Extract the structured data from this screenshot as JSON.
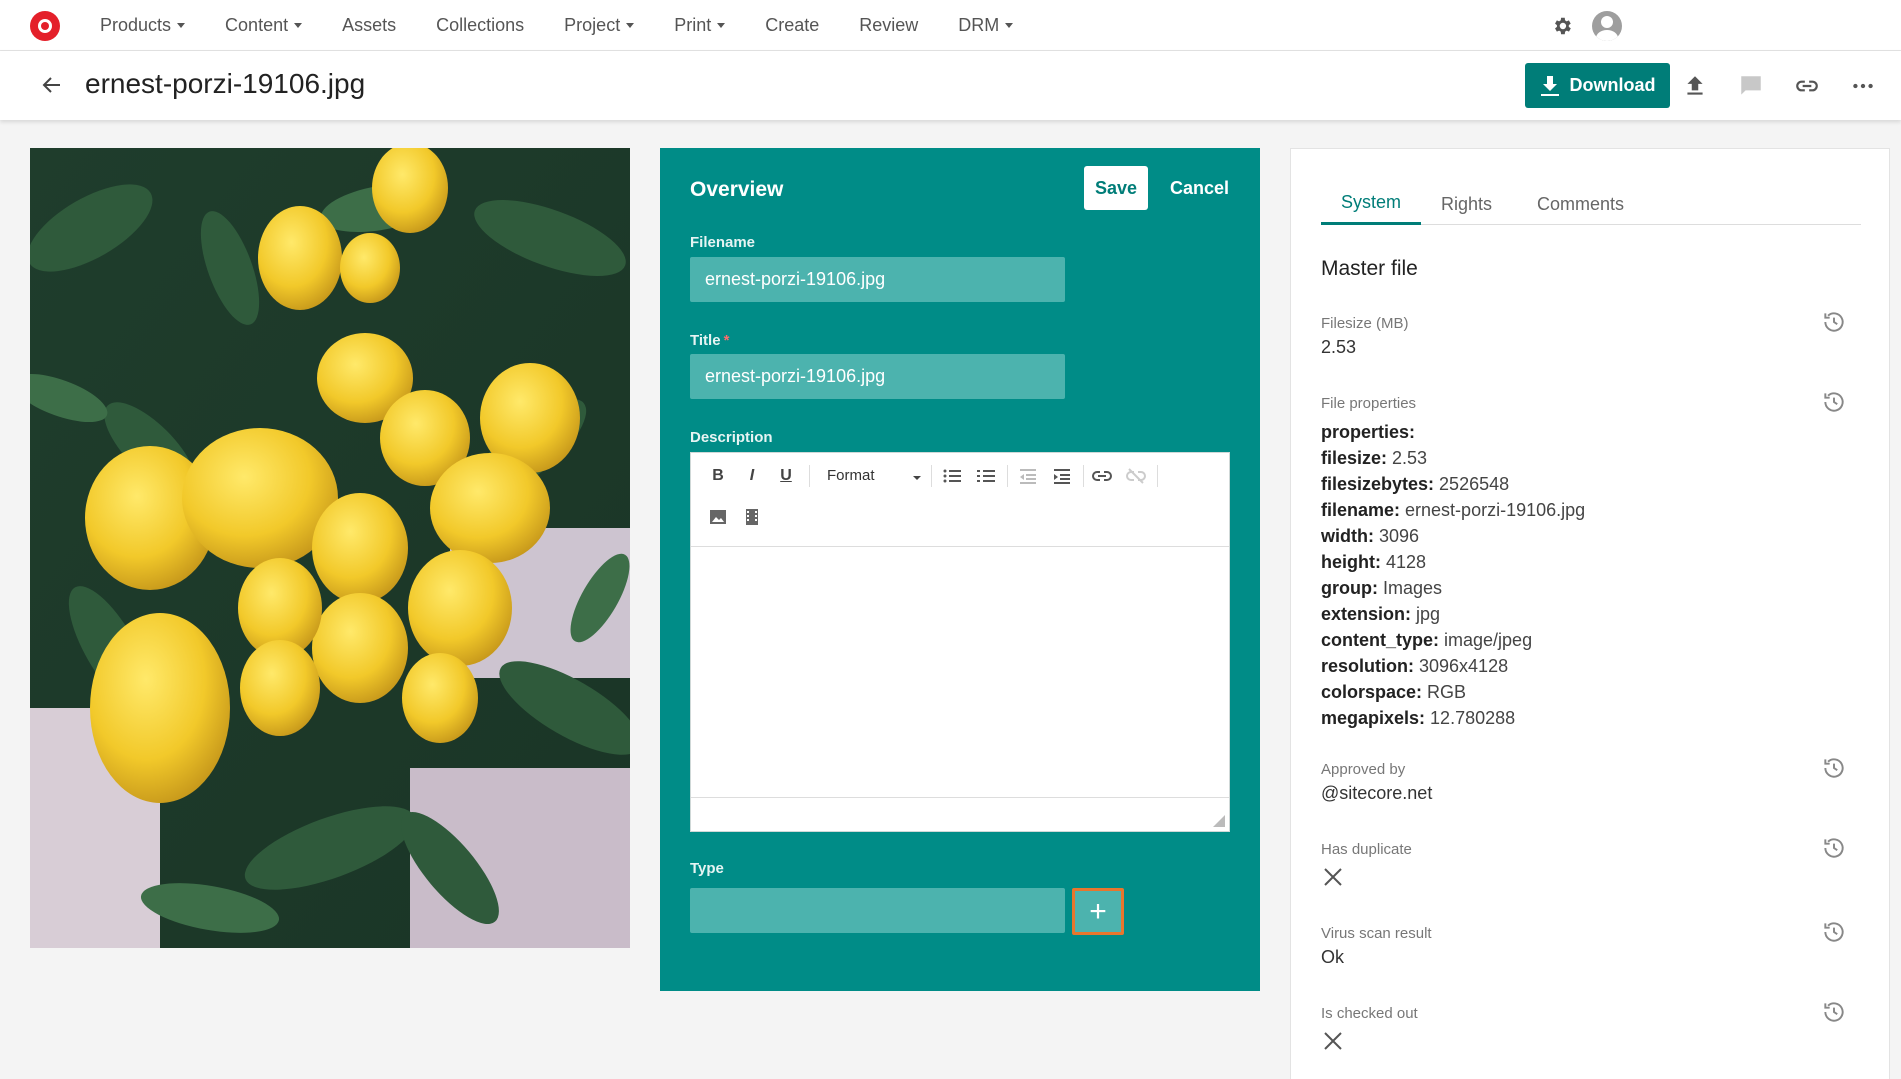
{
  "nav": {
    "items": [
      {
        "label": "Products",
        "dropdown": true
      },
      {
        "label": "Content",
        "dropdown": true
      },
      {
        "label": "Assets",
        "dropdown": false
      },
      {
        "label": "Collections",
        "dropdown": false
      },
      {
        "label": "Project",
        "dropdown": true
      },
      {
        "label": "Print",
        "dropdown": true
      },
      {
        "label": "Create",
        "dropdown": false
      },
      {
        "label": "Review",
        "dropdown": false
      },
      {
        "label": "DRM",
        "dropdown": true
      }
    ]
  },
  "header": {
    "title": "ernest-porzi-19106.jpg",
    "download_label": "Download"
  },
  "overview": {
    "title": "Overview",
    "save_label": "Save",
    "cancel_label": "Cancel",
    "filename_label": "Filename",
    "filename_value": "ernest-porzi-19106.jpg",
    "title_label": "Title",
    "title_required_mark": "*",
    "title_value": "ernest-porzi-19106.jpg",
    "description_label": "Description",
    "format_label": "Format",
    "type_label": "Type",
    "add_label": "+"
  },
  "right": {
    "tabs": [
      "System",
      "Rights",
      "Comments"
    ],
    "active_tab": "System",
    "section_title": "Master file",
    "filesize_label": "Filesize (MB)",
    "filesize_value": "2.53",
    "fileprops_label": "File properties",
    "fileprops": [
      {
        "key": "properties:",
        "value": ""
      },
      {
        "key": "filesize:",
        "value": " 2.53"
      },
      {
        "key": "filesizebytes:",
        "value": " 2526548"
      },
      {
        "key": "filename:",
        "value": " ernest-porzi-19106.jpg"
      },
      {
        "key": "width:",
        "value": " 3096"
      },
      {
        "key": "height:",
        "value": " 4128"
      },
      {
        "key": "group:",
        "value": " Images"
      },
      {
        "key": "extension:",
        "value": " jpg"
      },
      {
        "key": "content_type:",
        "value": " image/jpeg"
      },
      {
        "key": "resolution:",
        "value": " 3096x4128"
      },
      {
        "key": "colorspace:",
        "value": " RGB"
      },
      {
        "key": "megapixels:",
        "value": " 12.780288"
      }
    ],
    "approved_label": "Approved by",
    "approved_value": "@sitecore.net",
    "duplicate_label": "Has duplicate",
    "virus_label": "Virus scan result",
    "virus_value": "Ok",
    "checked_out_label": "Is checked out"
  },
  "colors": {
    "accent": "#007d78",
    "panel": "#008c87",
    "input": "#4cb3ae",
    "focus": "#e8762d",
    "logo": "#e4202a"
  }
}
